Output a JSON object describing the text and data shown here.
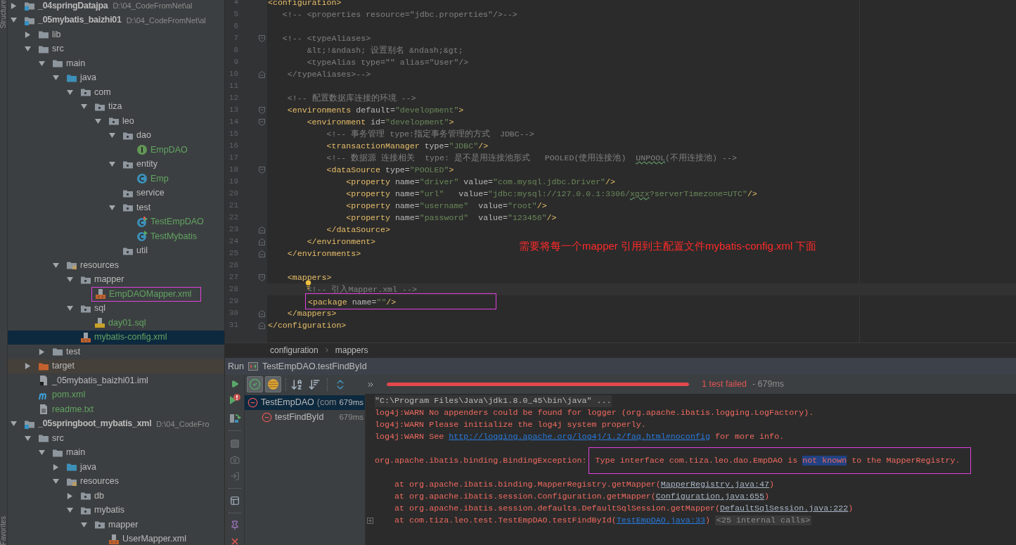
{
  "project": {
    "top_tab": "Structure",
    "bottom_tab": "Favorites",
    "tree": [
      {
        "name": "_04springDatajpa",
        "path": "D:\\04_CodeFromNet\\al",
        "kind": "module",
        "expanded": false,
        "selected": false,
        "added": false,
        "boxed": false
      },
      {
        "name": "_05mybatis_baizhi01",
        "path": "D:\\04_CodeFromNet\\al",
        "kind": "module",
        "expanded": true,
        "selected": false,
        "added": false,
        "boxed": false,
        "children": [
          {
            "name": "lib",
            "kind": "folder",
            "expanded": false,
            "selected": false,
            "added": false,
            "boxed": false
          },
          {
            "name": "src",
            "kind": "folder",
            "expanded": true,
            "selected": false,
            "added": false,
            "boxed": false,
            "children": [
              {
                "name": "main",
                "kind": "folder",
                "expanded": true,
                "selected": false,
                "added": false,
                "boxed": false,
                "children": [
                  {
                    "name": "java",
                    "kind": "source",
                    "expanded": true,
                    "selected": false,
                    "added": false,
                    "boxed": false,
                    "children": [
                      {
                        "name": "com",
                        "kind": "package",
                        "expanded": true,
                        "selected": false,
                        "added": false,
                        "boxed": false,
                        "children": [
                          {
                            "name": "tiza",
                            "kind": "package",
                            "expanded": true,
                            "selected": false,
                            "added": false,
                            "boxed": false,
                            "children": [
                              {
                                "name": "leo",
                                "kind": "package",
                                "expanded": true,
                                "selected": false,
                                "added": false,
                                "boxed": false,
                                "children": [
                                  {
                                    "name": "dao",
                                    "kind": "package",
                                    "expanded": true,
                                    "selected": false,
                                    "added": false,
                                    "boxed": false,
                                    "children": [
                                      {
                                        "name": "EmpDAO",
                                        "kind": "interface",
                                        "selected": false,
                                        "added": true,
                                        "boxed": false
                                      }
                                    ]
                                  },
                                  {
                                    "name": "entity",
                                    "kind": "package",
                                    "expanded": true,
                                    "selected": false,
                                    "added": false,
                                    "boxed": false,
                                    "children": [
                                      {
                                        "name": "Emp",
                                        "kind": "class",
                                        "selected": false,
                                        "added": true,
                                        "boxed": false
                                      }
                                    ]
                                  },
                                  {
                                    "name": "service",
                                    "kind": "package",
                                    "selected": false,
                                    "added": false,
                                    "boxed": false
                                  },
                                  {
                                    "name": "test",
                                    "kind": "package",
                                    "expanded": true,
                                    "selected": false,
                                    "added": false,
                                    "boxed": false,
                                    "children": [
                                      {
                                        "name": "TestEmpDAO",
                                        "kind": "test-failed",
                                        "selected": false,
                                        "added": true,
                                        "boxed": false
                                      },
                                      {
                                        "name": "TestMybatis",
                                        "kind": "test",
                                        "selected": false,
                                        "added": true,
                                        "boxed": false
                                      }
                                    ]
                                  },
                                  {
                                    "name": "util",
                                    "kind": "package",
                                    "selected": false,
                                    "added": false,
                                    "boxed": false
                                  }
                                ]
                              }
                            ]
                          }
                        ]
                      }
                    ]
                  },
                  {
                    "name": "resources",
                    "kind": "resources",
                    "expanded": true,
                    "selected": false,
                    "added": false,
                    "boxed": false,
                    "children": [
                      {
                        "name": "mapper",
                        "kind": "package",
                        "expanded": true,
                        "selected": false,
                        "added": false,
                        "boxed": false,
                        "children": [
                          {
                            "name": "EmpDAOMapper.xml",
                            "kind": "xml",
                            "selected": false,
                            "added": true,
                            "boxed": true
                          }
                        ]
                      },
                      {
                        "name": "sql",
                        "kind": "package",
                        "expanded": true,
                        "selected": false,
                        "added": false,
                        "boxed": false,
                        "children": [
                          {
                            "name": "day01.sql",
                            "kind": "sql",
                            "selected": false,
                            "added": true,
                            "boxed": false
                          }
                        ]
                      },
                      {
                        "name": "mybatis-config.xml",
                        "kind": "xml",
                        "selected": true,
                        "added": true,
                        "boxed": false
                      }
                    ]
                  }
                ]
              },
              {
                "name": "test",
                "kind": "folder",
                "expanded": false,
                "selected": false,
                "added": false,
                "boxed": false
              }
            ]
          },
          {
            "name": "target",
            "kind": "excluded",
            "expanded": false,
            "selected": false,
            "added": false,
            "boxed": false
          },
          {
            "name": "_05mybatis_baizhi01.iml",
            "kind": "iml",
            "selected": false,
            "added": false,
            "boxed": false
          },
          {
            "name": "pom.xml",
            "kind": "maven",
            "selected": false,
            "added": true,
            "boxed": false
          },
          {
            "name": "readme.txt",
            "kind": "text",
            "selected": false,
            "added": true,
            "boxed": false
          }
        ]
      },
      {
        "name": "_05springboot_mybatis_xml",
        "path": "D:\\04_CodeFro",
        "kind": "module",
        "expanded": true,
        "selected": false,
        "added": false,
        "boxed": false,
        "children": [
          {
            "name": "src",
            "kind": "folder",
            "expanded": true,
            "selected": false,
            "added": false,
            "boxed": false,
            "children": [
              {
                "name": "main",
                "kind": "folder",
                "expanded": true,
                "selected": false,
                "added": false,
                "boxed": false,
                "children": [
                  {
                    "name": "java",
                    "kind": "source",
                    "expanded": false,
                    "selected": false,
                    "added": false,
                    "boxed": false
                  },
                  {
                    "name": "resources",
                    "kind": "resources",
                    "expanded": true,
                    "selected": false,
                    "added": false,
                    "boxed": false,
                    "children": [
                      {
                        "name": "db",
                        "kind": "package",
                        "expanded": false,
                        "selected": false,
                        "added": false,
                        "boxed": false
                      },
                      {
                        "name": "mybatis",
                        "kind": "package",
                        "expanded": true,
                        "selected": false,
                        "added": false,
                        "boxed": false,
                        "children": [
                          {
                            "name": "mapper",
                            "kind": "package",
                            "expanded": true,
                            "selected": false,
                            "added": false,
                            "boxed": false,
                            "children": [
                              {
                                "name": "UserMapper.xml",
                                "kind": "xml",
                                "selected": false,
                                "added": false,
                                "boxed": false
                              }
                            ]
                          }
                        ]
                      }
                    ]
                  }
                ]
              }
            ]
          }
        ]
      }
    ]
  },
  "editor": {
    "note": "需要将每一个mapper 引用到主配置文件mybatis-config.xml 下面",
    "lines": [
      {
        "n": "4",
        "kind": "plain",
        "segs": [
          {
            "kind": "tag",
            "text": "<configuration>"
          }
        ]
      },
      {
        "n": "5",
        "kind": "plain",
        "segs": [
          {
            "kind": "comment",
            "text": "   <!-- <properties resource=\"jdbc.properties\"/>-->"
          }
        ]
      },
      {
        "n": "6",
        "kind": "plain"
      },
      {
        "n": "7",
        "kind": "fold-start",
        "segs": [
          {
            "kind": "comment",
            "text": "   <!-- <typeAliases>"
          }
        ]
      },
      {
        "n": "8",
        "kind": "plain",
        "segs": [
          {
            "kind": "comment",
            "text": "        &lt;!&ndash; 设置别名 &ndash;&gt;"
          }
        ]
      },
      {
        "n": "9",
        "kind": "plain",
        "segs": [
          {
            "kind": "comment",
            "text": "        <typeAlias type=\"\" alias=\"User\"/>"
          }
        ]
      },
      {
        "n": "10",
        "kind": "fold-end",
        "segs": [
          {
            "kind": "comment",
            "text": "    </typeAliases>-->"
          }
        ]
      },
      {
        "n": "11",
        "kind": "plain"
      },
      {
        "n": "12",
        "kind": "plain",
        "segs": [
          {
            "kind": "comment",
            "text": "    <!-- 配置数据库连接的环境 -->"
          }
        ]
      },
      {
        "n": "13",
        "kind": "fold-start",
        "segs": [
          {
            "kind": "tag",
            "text": "    <environments"
          },
          {
            "kind": "attr",
            "text": " default="
          },
          {
            "kind": "value",
            "text": "\"development\""
          },
          {
            "kind": "tag",
            "text": ">"
          }
        ]
      },
      {
        "n": "14",
        "kind": "fold-start",
        "segs": [
          {
            "kind": "tag",
            "text": "        <environment"
          },
          {
            "kind": "attr",
            "text": " id="
          },
          {
            "kind": "value",
            "text": "\"development\""
          },
          {
            "kind": "tag",
            "text": ">"
          }
        ]
      },
      {
        "n": "15",
        "kind": "plain",
        "segs": [
          {
            "kind": "comment",
            "text": "            <!-- 事务管理 type:指定事务管理的方式  JDBC-->"
          }
        ]
      },
      {
        "n": "16",
        "kind": "plain",
        "segs": [
          {
            "kind": "tag",
            "text": "            <transactionManager"
          },
          {
            "kind": "attr",
            "text": " type="
          },
          {
            "kind": "value",
            "text": "\"JDBC\""
          },
          {
            "kind": "tag",
            "text": "/>"
          }
        ]
      },
      {
        "n": "17",
        "kind": "plain",
        "segs": [
          {
            "kind": "comment",
            "text": "            <!-- 数据源 连接相关  type: 是不是用连接池形式   POOLED(使用连接池)  "
          },
          {
            "kind": "comment-typo",
            "text": "UNPOOL"
          },
          {
            "kind": "comment",
            "text": "(不用连接池) -->"
          }
        ]
      },
      {
        "n": "18",
        "kind": "fold-start",
        "segs": [
          {
            "kind": "tag",
            "text": "            <dataSource"
          },
          {
            "kind": "attr",
            "text": " type="
          },
          {
            "kind": "value",
            "text": "\"POOLED\""
          },
          {
            "kind": "tag",
            "text": ">"
          }
        ]
      },
      {
        "n": "19",
        "kind": "plain",
        "segs": [
          {
            "kind": "tag",
            "text": "                <property"
          },
          {
            "kind": "attr",
            "text": " name="
          },
          {
            "kind": "value",
            "text": "\"driver\""
          },
          {
            "kind": "attr",
            "text": " value="
          },
          {
            "kind": "value",
            "text": "\"com.mysql.jdbc.Driver\""
          },
          {
            "kind": "tag",
            "text": "/>"
          }
        ]
      },
      {
        "n": "20",
        "kind": "plain",
        "segs": [
          {
            "kind": "tag",
            "text": "                <property"
          },
          {
            "kind": "attr",
            "text": " name="
          },
          {
            "kind": "value",
            "text": "\"url\""
          },
          {
            "kind": "attr",
            "text": "   value="
          },
          {
            "kind": "value",
            "text": "\"jdbc:mysql://127.0.0.1:3306/"
          },
          {
            "kind": "value-typo",
            "text": "xgzx"
          },
          {
            "kind": "value",
            "text": "?serverTimezone=UTC\""
          },
          {
            "kind": "tag",
            "text": "/>"
          }
        ]
      },
      {
        "n": "21",
        "kind": "plain",
        "segs": [
          {
            "kind": "tag",
            "text": "                <property"
          },
          {
            "kind": "attr",
            "text": " name="
          },
          {
            "kind": "value",
            "text": "\"username\""
          },
          {
            "kind": "attr",
            "text": "  value="
          },
          {
            "kind": "value",
            "text": "\"root\""
          },
          {
            "kind": "tag",
            "text": "/>"
          }
        ]
      },
      {
        "n": "22",
        "kind": "plain",
        "segs": [
          {
            "kind": "tag",
            "text": "                <property"
          },
          {
            "kind": "attr",
            "text": " name="
          },
          {
            "kind": "value",
            "text": "\"password\""
          },
          {
            "kind": "attr",
            "text": "  value="
          },
          {
            "kind": "value",
            "text": "\"123456\""
          },
          {
            "kind": "tag",
            "text": "/>"
          }
        ]
      },
      {
        "n": "23",
        "kind": "fold-end",
        "segs": [
          {
            "kind": "tag",
            "text": "            </dataSource>"
          }
        ]
      },
      {
        "n": "24",
        "kind": "fold-end",
        "segs": [
          {
            "kind": "tag",
            "text": "        </environment>"
          }
        ]
      },
      {
        "n": "25",
        "kind": "fold-end",
        "segs": [
          {
            "kind": "tag",
            "text": "    </environments>"
          }
        ]
      },
      {
        "n": "26",
        "kind": "plain"
      },
      {
        "n": "27",
        "kind": "fold-start",
        "segs": [
          {
            "kind": "tag",
            "text": "    <mappers>"
          }
        ]
      },
      {
        "n": "28",
        "kind": "plain",
        "current": true,
        "bulb": true,
        "segs": [
          {
            "kind": "comment",
            "text": "        <!-- 引入Mapper.xml -->"
          }
        ]
      },
      {
        "n": "29",
        "kind": "plain",
        "boxed": true,
        "segs": [
          {
            "kind": "tag",
            "text": "<package"
          },
          {
            "kind": "attr",
            "text": " name="
          },
          {
            "kind": "value",
            "text": "\"\""
          },
          {
            "kind": "tag",
            "text": "/>"
          }
        ]
      },
      {
        "n": "30",
        "kind": "fold-end",
        "segs": [
          {
            "kind": "tag",
            "text": "    </mappers>"
          }
        ]
      },
      {
        "n": "31",
        "kind": "fold-end",
        "segs": [
          {
            "kind": "tag",
            "text": "</configuration>"
          }
        ]
      }
    ],
    "breadcrumbs": [
      "configuration",
      "mappers"
    ]
  },
  "run": {
    "title": "Run",
    "config": "TestEmpDAO.testFindById",
    "toggles": [
      {
        "kind": "passed",
        "on": true
      },
      {
        "kind": "ignored",
        "on": true
      }
    ],
    "progress": {
      "level": 1,
      "status": "1 test failed",
      "time": "- 679ms"
    },
    "tests": [
      {
        "name": "TestEmpDAO",
        "detail": "(com",
        "time": "679ms",
        "kind": "failed",
        "selected": true,
        "children": [
          {
            "name": "testFindById",
            "time": "679ms",
            "kind": "failed",
            "selected": false
          }
        ]
      }
    ],
    "console": [
      {
        "kind": "command",
        "segs": [
          {
            "kind": "text",
            "text": "\"C:\\Program Files\\Java\\jdk1.8.0_45\\bin\\java\" ..."
          }
        ]
      },
      {
        "kind": "error",
        "segs": [
          {
            "kind": "text",
            "text": "log4j:WARN No appenders could be found for logger (org.apache.ibatis.logging.LogFactory)."
          }
        ]
      },
      {
        "kind": "error",
        "segs": [
          {
            "kind": "text",
            "text": "log4j:WARN Please initialize the log4j system properly."
          }
        ]
      },
      {
        "kind": "error",
        "segs": [
          {
            "kind": "text",
            "text": "log4j:WARN See "
          },
          {
            "kind": "link",
            "text": "http://logging.apache.org/log4j/1.2/faq.html#noconfig"
          },
          {
            "kind": "text",
            "text": " for more info."
          }
        ]
      },
      {
        "kind": "blank"
      },
      {
        "kind": "error",
        "segs": [
          {
            "kind": "text",
            "text": "org.apache.ibatis.binding.BindingException:"
          },
          {
            "kind": "box",
            "parts": [
              {
                "kind": "text",
                "text": "Type interface com.tiza.leo.dao.EmpDAO is "
              },
              {
                "kind": "selection",
                "text": "not known"
              },
              {
                "kind": "text",
                "text": " to the MapperRegistry."
              }
            ]
          }
        ]
      },
      {
        "kind": "blank"
      },
      {
        "kind": "error",
        "segs": [
          {
            "kind": "text",
            "text": "    at org.apache.ibatis.binding.MapperRegistry.getMapper("
          },
          {
            "kind": "source",
            "text": "MapperRegistry.java:47"
          },
          {
            "kind": "text",
            "text": ")"
          }
        ]
      },
      {
        "kind": "error",
        "segs": [
          {
            "kind": "text",
            "text": "    at org.apache.ibatis.session.Configuration.getMapper("
          },
          {
            "kind": "source",
            "text": "Configuration.java:655"
          },
          {
            "kind": "text",
            "text": ")"
          }
        ]
      },
      {
        "kind": "error",
        "segs": [
          {
            "kind": "text",
            "text": "    at org.apache.ibatis.session.defaults.DefaultSqlSession.getMapper("
          },
          {
            "kind": "source",
            "text": "DefaultSqlSession.java:222"
          },
          {
            "kind": "text",
            "text": ")"
          }
        ]
      },
      {
        "kind": "error-folded",
        "segs": [
          {
            "kind": "text",
            "text": "    at com.tiza.leo.test.TestEmpDAO.testFindById("
          },
          {
            "kind": "link",
            "text": "TestEmpDAO.java:33"
          },
          {
            "kind": "text",
            "text": ")"
          },
          {
            "kind": "fold",
            "text": "<25 internal calls>"
          }
        ]
      }
    ]
  }
}
